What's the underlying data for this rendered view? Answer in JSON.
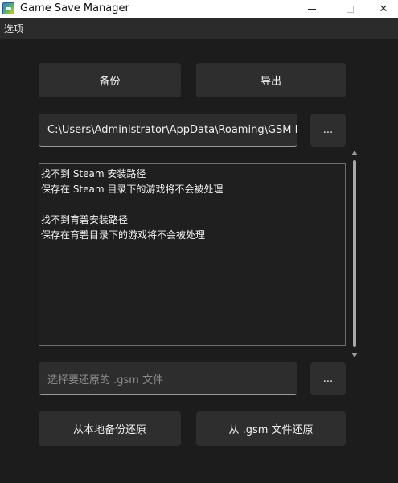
{
  "window": {
    "title": "Game Save Manager",
    "close_glyph": "✕"
  },
  "menu": {
    "options_label": "选项"
  },
  "actions": {
    "backup_label": "备份",
    "export_label": "导出"
  },
  "backup_path": {
    "value": "C:\\Users\\Administrator\\AppData\\Roaming\\GSM Ba",
    "browse_label": "..."
  },
  "log": {
    "lines": [
      "找不到 Steam 安装路径",
      "保存在 Steam 目录下的游戏将不会被处理",
      "",
      "找不到育碧安装路径",
      "保存在育碧目录下的游戏将不会被处理"
    ]
  },
  "restore_file": {
    "placeholder": "选择要还原的 .gsm 文件",
    "browse_label": "..."
  },
  "restore": {
    "local_label": "从本地备份还原",
    "gsm_label": "从 .gsm 文件还原"
  },
  "icons": {
    "app": "game-save-manager-app-icon",
    "minimize": "minimize-icon",
    "maximize": "maximize-icon",
    "close": "close-icon",
    "scroll_up": "scroll-up-arrow-icon",
    "scroll_down": "scroll-down-arrow-icon"
  }
}
